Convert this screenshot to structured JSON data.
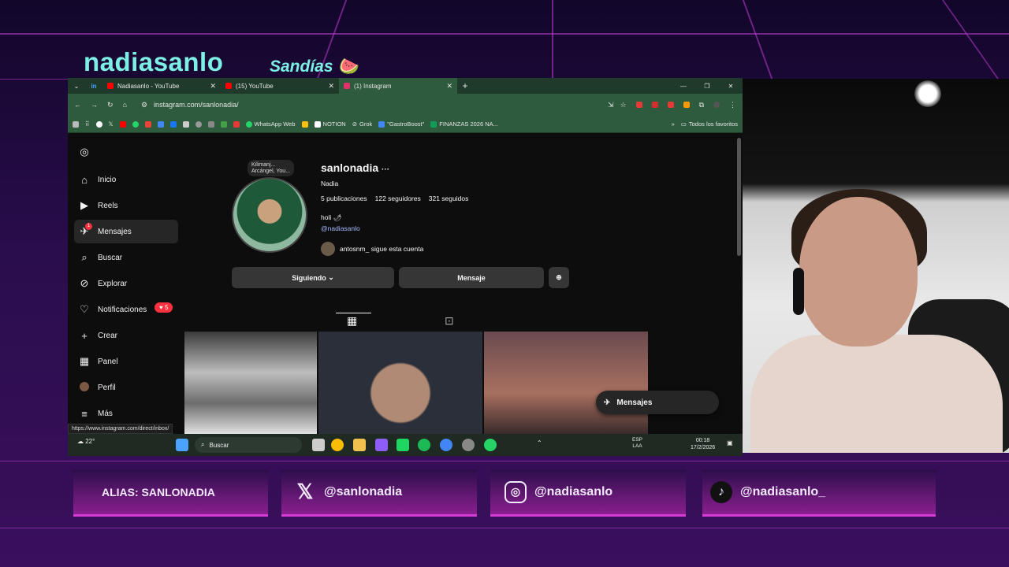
{
  "overlay": {
    "brand": "nadiasanlo",
    "tagline": "Sandías 🍉"
  },
  "browser": {
    "tabs": [
      {
        "label": "Nadiasanlo - YouTube",
        "icon": "youtube-icon"
      },
      {
        "label": "(15) YouTube",
        "icon": "youtube-icon"
      },
      {
        "label": "(1) Instagram",
        "icon": "instagram-icon"
      }
    ],
    "url": "instagram.com/sanlonadia/",
    "bookmarks": [
      "WhatsApp Web",
      "NOTION",
      "Grok",
      "\"GastroBoost\"",
      "FINANZAS 2026 NA...",
      "Todos los favoritos"
    ],
    "status_url": "https://www.instagram.com/direct/inbox/"
  },
  "instagram": {
    "nav": [
      {
        "label": "Inicio",
        "icon": "home-icon"
      },
      {
        "label": "Reels",
        "icon": "reels-icon"
      },
      {
        "label": "Mensajes",
        "icon": "messenger-icon"
      },
      {
        "label": "Buscar",
        "icon": "search-icon"
      },
      {
        "label": "Explorar",
        "icon": "compass-icon"
      },
      {
        "label": "Notificaciones",
        "icon": "heart-icon"
      },
      {
        "label": "Crear",
        "icon": "plus-icon"
      },
      {
        "label": "Panel",
        "icon": "chart-icon"
      },
      {
        "label": "Perfil",
        "icon": "avatar-icon"
      },
      {
        "label": "Más",
        "icon": "menu-icon"
      }
    ],
    "notifications_count": "5",
    "messages_badge": "1",
    "note": "Kilimanj...\nArcángel, You...",
    "profile": {
      "username": "sanlonadia",
      "full_name": "Nadia",
      "posts": "5 publicaciones",
      "followers": "122 seguidores",
      "following": "321 seguidos",
      "bio": "holi 🌶",
      "link": "@nadiasanlo",
      "followed_by": "antosnm_ sigue esta cuenta"
    },
    "buttons": {
      "following": "Siguiendo",
      "message": "Mensaje"
    },
    "floating_messages": "Mensajes"
  },
  "taskbar": {
    "temp": "22°",
    "search": "Buscar",
    "lang": "ESP\nLAA",
    "time": "00:18",
    "date": "17/2/2026"
  },
  "socials": [
    {
      "label": "ALIAS: SANLONADIA",
      "icon": ""
    },
    {
      "label": "@sanlonadia",
      "icon": "x-icon"
    },
    {
      "label": "@nadiasanlo",
      "icon": "instagram-icon"
    },
    {
      "label": "@nadiasanlo_",
      "icon": "tiktok-icon"
    }
  ],
  "colors": {
    "accent": "#7df0e6",
    "neon": "#d93ad6",
    "badge": "#ff3040"
  }
}
